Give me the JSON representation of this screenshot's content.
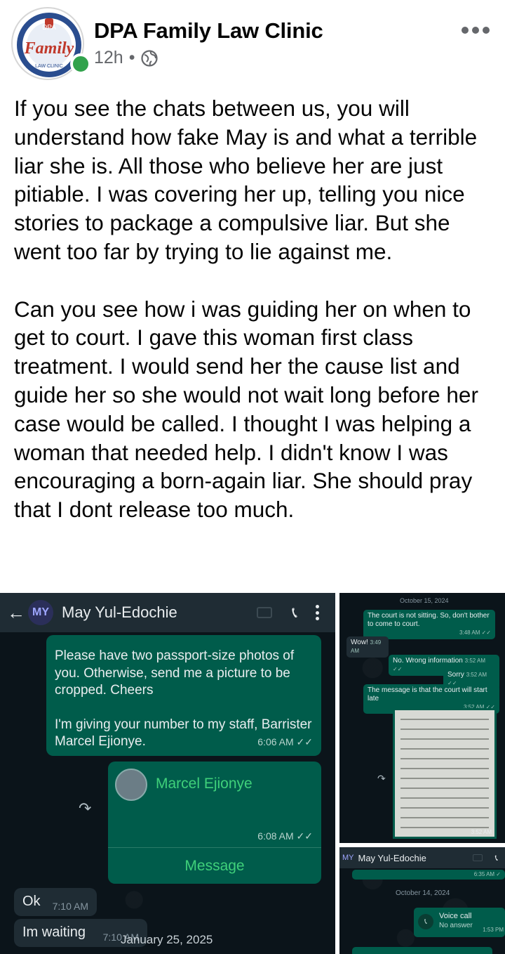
{
  "post": {
    "page_name": "DPA Family Law Clinic",
    "time": "12h",
    "separator": "•",
    "logo_text": "Family",
    "logo_subtext": "LAW CLINIC",
    "logo_top_text": "DPA",
    "paragraphs": [
      "If you see the chats between us, you will understand how fake May is and what a terrible liar she is. All those who believe her are just pitiable. I was covering her up, telling you nice stories to package a compulsive liar. But she went too far by trying to lie against me.",
      "Can you see how i was guiding her on when to get to court. I gave this woman first class treatment. I would send her the cause list and guide her so she would not wait long before her case would be called. I thought I was helping a woman that needed help. I didn't know I was encouraging a born-again liar. She should pray that I dont release too much."
    ]
  },
  "chat_main": {
    "avatar_initials": "MY",
    "contact_name": "May Yul-Edochie",
    "msg1_line1": "Please have two passport-size photos of you. Otherwise, send me a picture to be cropped. Cheers",
    "msg1_line2": "I'm giving your number to my staff, Barrister Marcel Ejionye.",
    "msg1_time": "6:06 AM ✓✓",
    "contact_card_name": "Marcel Ejionye",
    "contact_card_time": "6:08 AM ✓✓",
    "contact_card_action": "Message",
    "in1_text": "Ok",
    "in1_time": "7:10 AM",
    "in2_text": "Im waiting",
    "in2_time": "7:10 AM",
    "date_label": "January 25, 2025"
  },
  "chat_right_top": {
    "date": "October 15, 2024",
    "m1": "The court is not sitting. So, don't bother to come to court.",
    "m1_time": "3:48 AM ✓✓",
    "m2": "Wow!",
    "m2_time": "3:49 AM",
    "m3": "No. Wrong information",
    "m3_time": "3:52 AM ✓✓",
    "m4": "Sorry",
    "m4_time": "3:52 AM ✓✓",
    "m5": "The message is that the court will start late",
    "m5_time": "3:52 AM ✓✓",
    "img_time": "3:52 AM"
  },
  "chat_right_bottom": {
    "avatar_initials": "MY",
    "contact_name": "May Yul-Edochie",
    "top_time": "6:35 AM ✓",
    "date": "October 14, 2024",
    "call_title": "Voice call",
    "call_sub": "No answer",
    "call_time": "1:53 PM"
  }
}
